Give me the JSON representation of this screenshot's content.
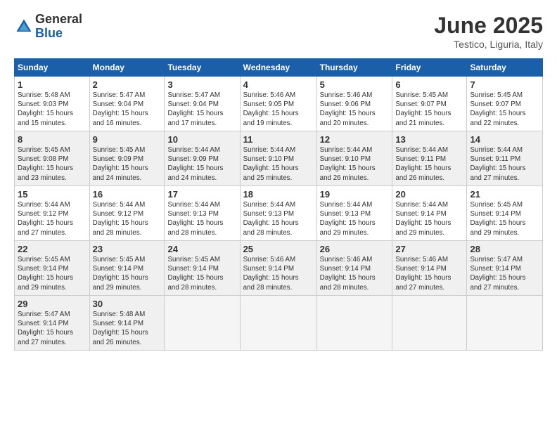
{
  "header": {
    "logo_general": "General",
    "logo_blue": "Blue",
    "month_title": "June 2025",
    "location": "Testico, Liguria, Italy"
  },
  "weekdays": [
    "Sunday",
    "Monday",
    "Tuesday",
    "Wednesday",
    "Thursday",
    "Friday",
    "Saturday"
  ],
  "weeks": [
    [
      {
        "day": "1",
        "info": "Sunrise: 5:48 AM\nSunset: 9:03 PM\nDaylight: 15 hours\nand 15 minutes."
      },
      {
        "day": "2",
        "info": "Sunrise: 5:47 AM\nSunset: 9:04 PM\nDaylight: 15 hours\nand 16 minutes."
      },
      {
        "day": "3",
        "info": "Sunrise: 5:47 AM\nSunset: 9:04 PM\nDaylight: 15 hours\nand 17 minutes."
      },
      {
        "day": "4",
        "info": "Sunrise: 5:46 AM\nSunset: 9:05 PM\nDaylight: 15 hours\nand 19 minutes."
      },
      {
        "day": "5",
        "info": "Sunrise: 5:46 AM\nSunset: 9:06 PM\nDaylight: 15 hours\nand 20 minutes."
      },
      {
        "day": "6",
        "info": "Sunrise: 5:45 AM\nSunset: 9:07 PM\nDaylight: 15 hours\nand 21 minutes."
      },
      {
        "day": "7",
        "info": "Sunrise: 5:45 AM\nSunset: 9:07 PM\nDaylight: 15 hours\nand 22 minutes."
      }
    ],
    [
      {
        "day": "8",
        "info": "Sunrise: 5:45 AM\nSunset: 9:08 PM\nDaylight: 15 hours\nand 23 minutes."
      },
      {
        "day": "9",
        "info": "Sunrise: 5:45 AM\nSunset: 9:09 PM\nDaylight: 15 hours\nand 24 minutes."
      },
      {
        "day": "10",
        "info": "Sunrise: 5:44 AM\nSunset: 9:09 PM\nDaylight: 15 hours\nand 24 minutes."
      },
      {
        "day": "11",
        "info": "Sunrise: 5:44 AM\nSunset: 9:10 PM\nDaylight: 15 hours\nand 25 minutes."
      },
      {
        "day": "12",
        "info": "Sunrise: 5:44 AM\nSunset: 9:10 PM\nDaylight: 15 hours\nand 26 minutes."
      },
      {
        "day": "13",
        "info": "Sunrise: 5:44 AM\nSunset: 9:11 PM\nDaylight: 15 hours\nand 26 minutes."
      },
      {
        "day": "14",
        "info": "Sunrise: 5:44 AM\nSunset: 9:11 PM\nDaylight: 15 hours\nand 27 minutes."
      }
    ],
    [
      {
        "day": "15",
        "info": "Sunrise: 5:44 AM\nSunset: 9:12 PM\nDaylight: 15 hours\nand 27 minutes."
      },
      {
        "day": "16",
        "info": "Sunrise: 5:44 AM\nSunset: 9:12 PM\nDaylight: 15 hours\nand 28 minutes."
      },
      {
        "day": "17",
        "info": "Sunrise: 5:44 AM\nSunset: 9:13 PM\nDaylight: 15 hours\nand 28 minutes."
      },
      {
        "day": "18",
        "info": "Sunrise: 5:44 AM\nSunset: 9:13 PM\nDaylight: 15 hours\nand 28 minutes."
      },
      {
        "day": "19",
        "info": "Sunrise: 5:44 AM\nSunset: 9:13 PM\nDaylight: 15 hours\nand 29 minutes."
      },
      {
        "day": "20",
        "info": "Sunrise: 5:44 AM\nSunset: 9:14 PM\nDaylight: 15 hours\nand 29 minutes."
      },
      {
        "day": "21",
        "info": "Sunrise: 5:45 AM\nSunset: 9:14 PM\nDaylight: 15 hours\nand 29 minutes."
      }
    ],
    [
      {
        "day": "22",
        "info": "Sunrise: 5:45 AM\nSunset: 9:14 PM\nDaylight: 15 hours\nand 29 minutes."
      },
      {
        "day": "23",
        "info": "Sunrise: 5:45 AM\nSunset: 9:14 PM\nDaylight: 15 hours\nand 29 minutes."
      },
      {
        "day": "24",
        "info": "Sunrise: 5:45 AM\nSunset: 9:14 PM\nDaylight: 15 hours\nand 28 minutes."
      },
      {
        "day": "25",
        "info": "Sunrise: 5:46 AM\nSunset: 9:14 PM\nDaylight: 15 hours\nand 28 minutes."
      },
      {
        "day": "26",
        "info": "Sunrise: 5:46 AM\nSunset: 9:14 PM\nDaylight: 15 hours\nand 28 minutes."
      },
      {
        "day": "27",
        "info": "Sunrise: 5:46 AM\nSunset: 9:14 PM\nDaylight: 15 hours\nand 27 minutes."
      },
      {
        "day": "28",
        "info": "Sunrise: 5:47 AM\nSunset: 9:14 PM\nDaylight: 15 hours\nand 27 minutes."
      }
    ],
    [
      {
        "day": "29",
        "info": "Sunrise: 5:47 AM\nSunset: 9:14 PM\nDaylight: 15 hours\nand 27 minutes."
      },
      {
        "day": "30",
        "info": "Sunrise: 5:48 AM\nSunset: 9:14 PM\nDaylight: 15 hours\nand 26 minutes."
      },
      {
        "day": "",
        "info": ""
      },
      {
        "day": "",
        "info": ""
      },
      {
        "day": "",
        "info": ""
      },
      {
        "day": "",
        "info": ""
      },
      {
        "day": "",
        "info": ""
      }
    ]
  ]
}
